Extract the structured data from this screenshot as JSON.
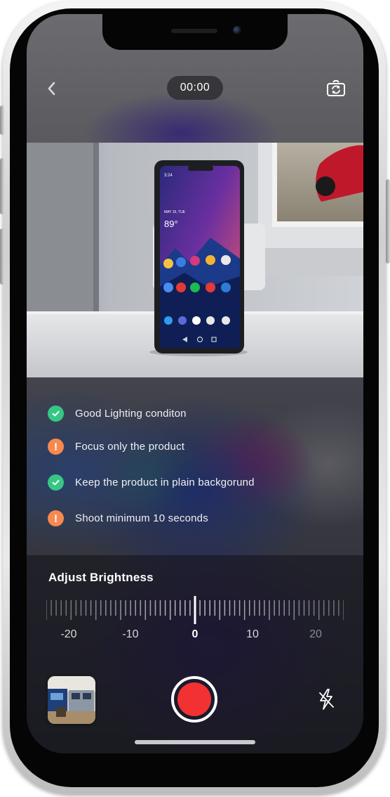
{
  "status": {
    "timer": "00:00"
  },
  "icons": {
    "back": "chevron-left-icon",
    "switch_camera": "switch-camera-icon",
    "flash": "flash-off-icon",
    "check": "check-icon",
    "warning": "exclamation-icon"
  },
  "checklist": [
    {
      "text": "Good Lighting conditon",
      "status": "ok"
    },
    {
      "text": "Focus only the product",
      "status": "warning"
    },
    {
      "text": "Keep the product in plain backgorund",
      "status": "ok"
    },
    {
      "text": "Shoot minimum 10 seconds",
      "status": "warning"
    }
  ],
  "brightness": {
    "title": "Adjust Brightness",
    "value": 0,
    "tick_labels": [
      "-20",
      "-10",
      "0",
      "10",
      "20"
    ]
  },
  "preview_phone": {
    "date": "MAY 15, TUE",
    "temp": "89°",
    "time": "3:24"
  },
  "colors": {
    "ok": "#37c785",
    "warning": "#f7894f",
    "record": "#f23232"
  }
}
